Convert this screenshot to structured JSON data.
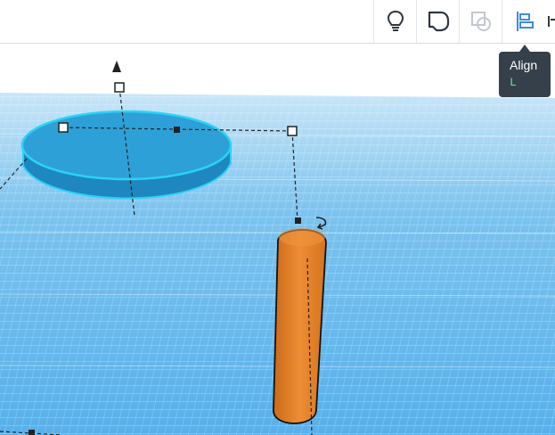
{
  "toolbar": {
    "buttons": [
      {
        "name": "notes",
        "icon": "lightbulb-icon",
        "state": "enabled"
      },
      {
        "name": "group",
        "icon": "group-shape-icon",
        "state": "enabled"
      },
      {
        "name": "ungroup",
        "icon": "ungroup-shapes-icon",
        "state": "disabled"
      },
      {
        "name": "align",
        "icon": "align-left-icon",
        "state": "active"
      }
    ]
  },
  "tooltip": {
    "title": "Align",
    "shortcut": "L"
  },
  "scene": {
    "grid_color": "#2f9be0",
    "selected_shape": {
      "name": "disc",
      "color": "#2ea0d8",
      "outline": "#2ad3f5"
    },
    "other_shape": {
      "name": "cylinder",
      "color": "#e5832c"
    },
    "selection_handles": [
      "top-handle",
      "left-handle",
      "center-handle",
      "corner-handle",
      "rotate-handle"
    ]
  },
  "colors": {
    "accent": "#3b8ce0",
    "tooltip_bg": "#36404a",
    "shortcut": "#6ee08a"
  }
}
